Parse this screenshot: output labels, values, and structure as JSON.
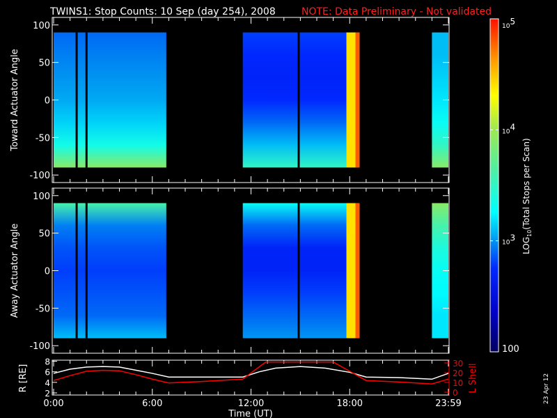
{
  "title": "TWINS1: Stop Counts: 10 Sep (day 254), 2008",
  "note": "NOTE: Data Preliminary - Not validated",
  "side_label": "23 Apr 12",
  "colors": {
    "note": "#ff2020",
    "lshell": "#ff0000",
    "radius": "#ffffff"
  },
  "chart_data": [
    {
      "type": "heatmap",
      "panel": "toward",
      "ylabel": "Toward Actuator Angle",
      "ylim": [
        -110,
        110
      ],
      "yticks": [
        "100",
        "50",
        "0",
        "-50",
        "-100"
      ],
      "ytick_values": [
        100,
        50,
        0,
        -50,
        -100
      ],
      "xlim_hours": [
        0,
        24
      ],
      "angle_range": [
        -90,
        90
      ],
      "angle_samples": [
        90,
        60,
        30,
        0,
        -30,
        -60,
        -90
      ],
      "blocks": [
        {
          "start": 0.0,
          "end": 6.85,
          "log10_profile": [
            2.9,
            2.95,
            3.0,
            3.05,
            3.15,
            3.35,
            3.9
          ]
        },
        {
          "start": 11.5,
          "end": 17.8,
          "log10_profile": [
            2.8,
            2.75,
            2.7,
            2.75,
            2.9,
            3.1,
            3.5
          ]
        },
        {
          "start": 17.8,
          "end": 18.6,
          "log10_profile": [
            4.4,
            4.4,
            4.4,
            4.4,
            4.4,
            4.4,
            4.4
          ]
        },
        {
          "start": 23.0,
          "end": 24.0,
          "log10_profile": [
            3.1,
            3.1,
            3.15,
            3.2,
            3.3,
            3.5,
            3.9
          ]
        }
      ],
      "gaps_hours": [
        1.4,
        2.0,
        14.9
      ]
    },
    {
      "type": "heatmap",
      "panel": "away",
      "ylabel": "Away Actuator Angle",
      "ylim": [
        -110,
        110
      ],
      "yticks": [
        "100",
        "50",
        "0",
        "-50",
        "-100"
      ],
      "ytick_values": [
        100,
        50,
        0,
        -50,
        -100
      ],
      "xlim_hours": [
        0,
        24
      ],
      "angle_range": [
        -90,
        90
      ],
      "angle_samples": [
        90,
        60,
        30,
        0,
        -30,
        -60,
        -90
      ],
      "blocks": [
        {
          "start": 0.0,
          "end": 6.85,
          "log10_profile": [
            3.6,
            2.95,
            2.85,
            2.8,
            2.85,
            2.9,
            3.1
          ]
        },
        {
          "start": 11.5,
          "end": 17.8,
          "log10_profile": [
            3.3,
            2.9,
            2.7,
            2.7,
            2.8,
            2.9,
            3.0
          ]
        },
        {
          "start": 17.8,
          "end": 18.6,
          "log10_profile": [
            4.4,
            4.4,
            4.4,
            4.4,
            4.4,
            4.4,
            4.4
          ]
        },
        {
          "start": 23.0,
          "end": 24.0,
          "log10_profile": [
            3.9,
            3.6,
            3.4,
            3.3,
            3.25,
            3.2,
            3.2
          ]
        }
      ],
      "gaps_hours": [
        1.4,
        2.0,
        14.9
      ]
    },
    {
      "type": "line",
      "panel": "orbit",
      "xlabel": "Time (UT)",
      "xticks": [
        "0:00",
        "6:00",
        "12:00",
        "18:00",
        "23:59"
      ],
      "xtick_hours": [
        0,
        6,
        12,
        18,
        24
      ],
      "ylabel": "R [RE]",
      "ylim": [
        1.6,
        8.2
      ],
      "yticks": [
        "8",
        "6",
        "4",
        "2"
      ],
      "ytick_values": [
        8,
        6,
        4,
        2
      ],
      "y2label": "L Shell",
      "y2lim": [
        0,
        30
      ],
      "y2ticks": [
        "30",
        "20",
        "10",
        "0"
      ],
      "y2tick_values": [
        30,
        20,
        10,
        0
      ],
      "series": [
        {
          "name": "R",
          "axis": "left",
          "x": [
            0,
            1,
            2,
            3,
            4,
            5,
            6,
            7,
            9,
            11.5,
            12.5,
            13.5,
            15,
            16.5,
            18,
            19,
            21,
            23,
            24
          ],
          "y": [
            5.7,
            6.5,
            6.9,
            7.0,
            6.9,
            6.3,
            5.7,
            5.0,
            5.0,
            5.0,
            6.0,
            6.7,
            7.0,
            6.7,
            5.9,
            5.0,
            4.9,
            4.6,
            5.7
          ]
        },
        {
          "name": "L Shell",
          "axis": "right",
          "x": [
            0,
            1,
            2,
            3,
            4,
            5,
            6,
            7,
            9,
            11.5,
            12.9,
            17.0,
            19.0,
            21,
            23,
            24
          ],
          "y": [
            12,
            17,
            21.5,
            22.5,
            22,
            18,
            13.5,
            9.5,
            11,
            13.5,
            31,
            31,
            12,
            10.5,
            8.5,
            13.5
          ]
        }
      ]
    },
    {
      "type": "colorbar",
      "label": "LOG10(Total Stops per Scan)",
      "label_main": "LOG",
      "label_sub": "10",
      "label_rest": "(Total Stops per Scan)",
      "range_log10": [
        2,
        5
      ],
      "ticks": [
        {
          "log10": 5,
          "base": "10",
          "exp": "5"
        },
        {
          "log10": 4,
          "base": "10",
          "exp": "4"
        },
        {
          "log10": 3,
          "base": "10",
          "exp": "3"
        },
        {
          "log10": 2,
          "base": "100",
          "exp": ""
        }
      ]
    }
  ]
}
